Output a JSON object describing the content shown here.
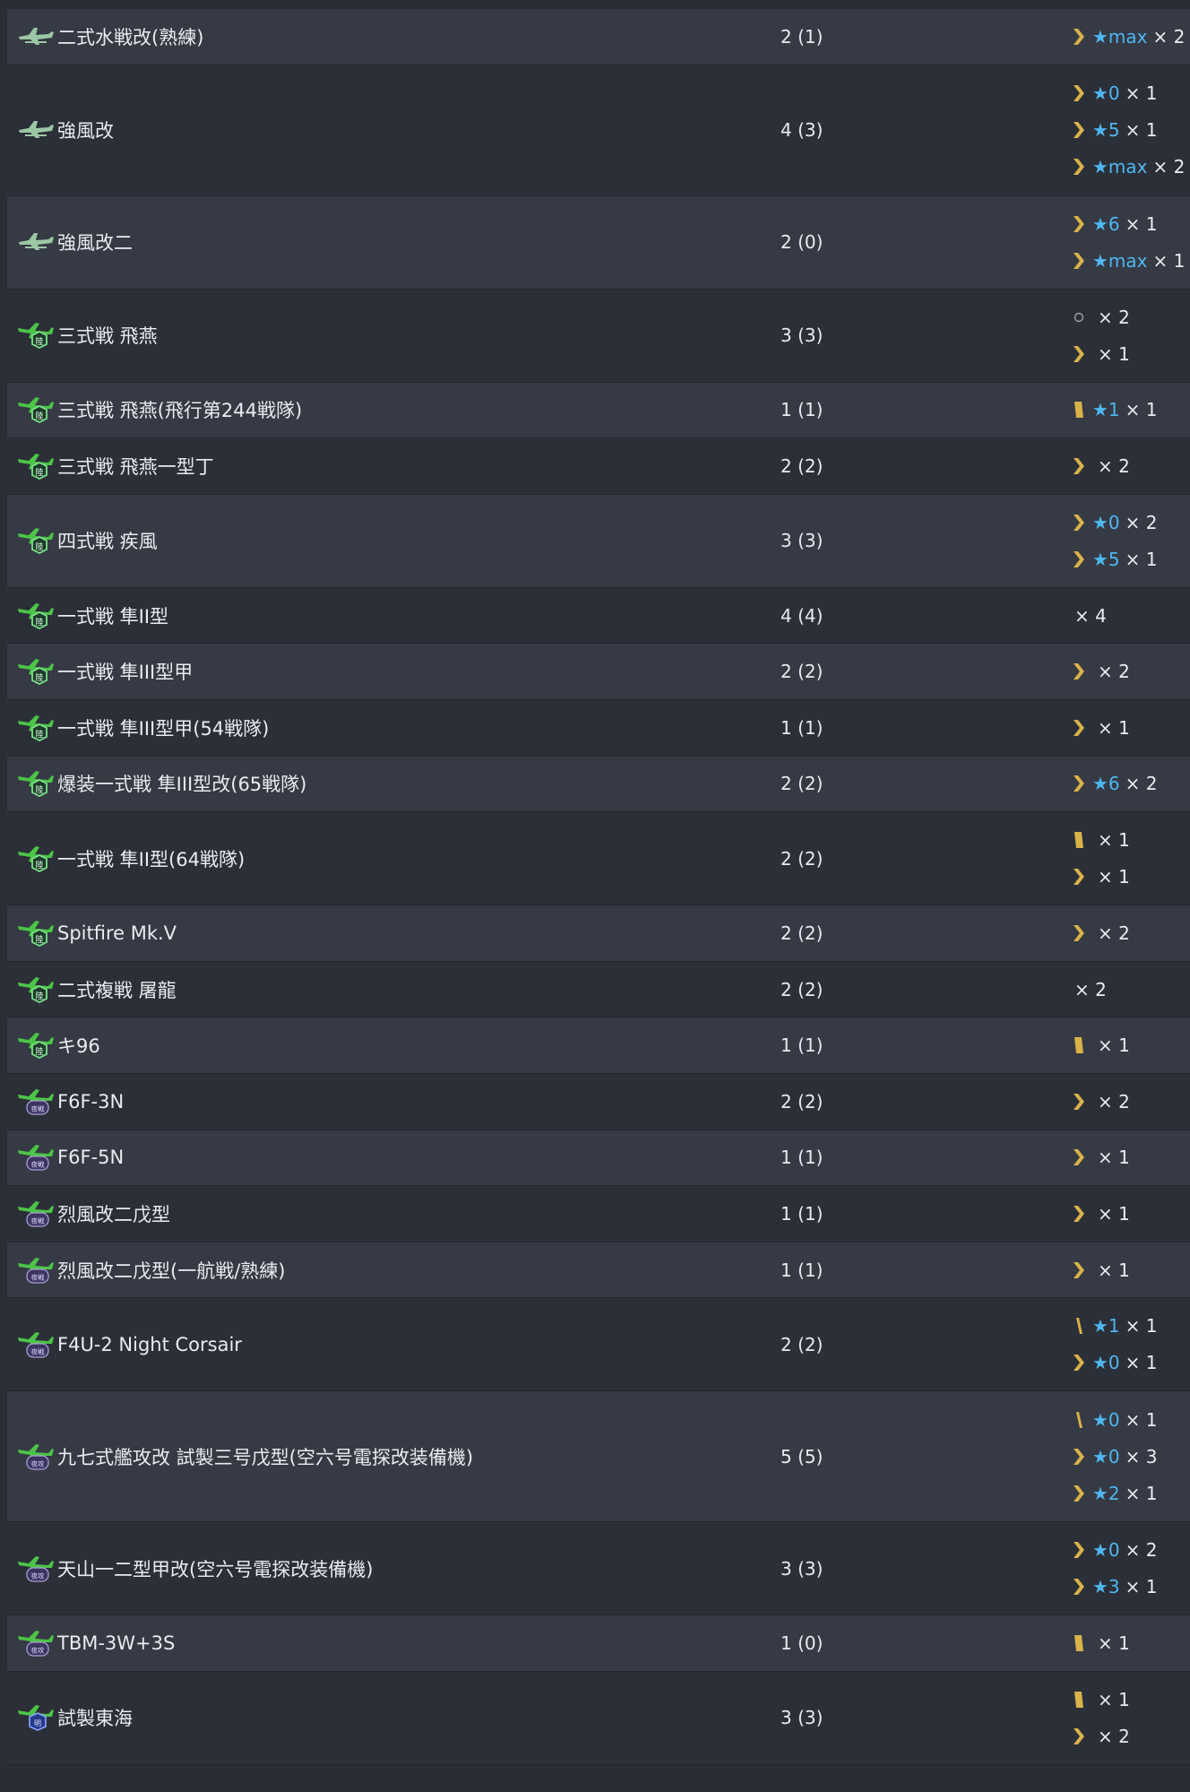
{
  "rows": [
    {
      "icon": "seaplane-fighter-icon",
      "name": "二式水戦改(熟練)",
      "count": "2 (1)",
      "prof": [
        {
          "icon": "chevron-double",
          "star": "★max",
          "mult": "× 2"
        }
      ]
    },
    {
      "icon": "seaplane-fighter-icon",
      "name": "強風改",
      "count": "4 (3)",
      "prof": [
        {
          "icon": "chevron-double",
          "star": "★0",
          "mult": "× 1"
        },
        {
          "icon": "chevron-double",
          "star": "★5",
          "mult": "× 1"
        },
        {
          "icon": "chevron-double",
          "star": "★max",
          "mult": "× 2"
        }
      ]
    },
    {
      "icon": "seaplane-fighter-icon",
      "name": "強風改二",
      "count": "2 (0)",
      "prof": [
        {
          "icon": "chevron-double",
          "star": "★6",
          "mult": "× 1"
        },
        {
          "icon": "chevron-double",
          "star": "★max",
          "mult": "× 1"
        }
      ]
    },
    {
      "icon": "army-fighter-icon",
      "name": "三式戦 飛燕",
      "count": "3 (3)",
      "prof": [
        {
          "icon": "circle-empty",
          "star": "",
          "mult": "× 2"
        },
        {
          "icon": "chevron-double",
          "star": "",
          "mult": "× 1"
        }
      ]
    },
    {
      "icon": "army-fighter-icon",
      "name": "三式戦 飛燕(飛行第244戦隊)",
      "count": "1 (1)",
      "prof": [
        {
          "icon": "bar-single",
          "star": "★1",
          "mult": "× 1"
        }
      ]
    },
    {
      "icon": "army-fighter-icon",
      "name": "三式戦 飛燕一型丁",
      "count": "2 (2)",
      "prof": [
        {
          "icon": "chevron-double",
          "star": "",
          "mult": "× 2"
        }
      ]
    },
    {
      "icon": "army-fighter-icon",
      "name": "四式戦 疾風",
      "count": "3 (3)",
      "prof": [
        {
          "icon": "chevron-double",
          "star": "★0",
          "mult": "× 2"
        },
        {
          "icon": "chevron-double",
          "star": "★5",
          "mult": "× 1"
        }
      ]
    },
    {
      "icon": "army-fighter-icon",
      "name": "一式戦 隼II型",
      "count": "4 (4)",
      "prof": [
        {
          "icon": "none",
          "star": "",
          "mult": "× 4"
        }
      ]
    },
    {
      "icon": "army-fighter-icon",
      "name": "一式戦 隼III型甲",
      "count": "2 (2)",
      "prof": [
        {
          "icon": "chevron-double",
          "star": "",
          "mult": "× 2"
        }
      ]
    },
    {
      "icon": "army-fighter-icon",
      "name": "一式戦 隼III型甲(54戦隊)",
      "count": "1 (1)",
      "prof": [
        {
          "icon": "chevron-double",
          "star": "",
          "mult": "× 1"
        }
      ]
    },
    {
      "icon": "army-fighter-icon",
      "name": "爆装一式戦 隼III型改(65戦隊)",
      "count": "2 (2)",
      "prof": [
        {
          "icon": "chevron-double",
          "star": "★6",
          "mult": "× 2"
        }
      ]
    },
    {
      "icon": "army-fighter-icon",
      "name": "一式戦 隼II型(64戦隊)",
      "count": "2 (2)",
      "prof": [
        {
          "icon": "bar-single",
          "star": "",
          "mult": "× 1"
        },
        {
          "icon": "chevron-double",
          "star": "",
          "mult": "× 1"
        }
      ]
    },
    {
      "icon": "army-fighter-icon",
      "name": "Spitfire Mk.V",
      "count": "2 (2)",
      "prof": [
        {
          "icon": "chevron-double",
          "star": "",
          "mult": "× 2"
        }
      ]
    },
    {
      "icon": "army-fighter-icon",
      "name": "二式複戦 屠龍",
      "count": "2 (2)",
      "prof": [
        {
          "icon": "none",
          "star": "",
          "mult": "× 2"
        }
      ]
    },
    {
      "icon": "army-fighter-icon",
      "name": "キ96",
      "count": "1 (1)",
      "prof": [
        {
          "icon": "bar-single",
          "star": "",
          "mult": "× 1"
        }
      ]
    },
    {
      "icon": "night-fighter-icon",
      "name": "F6F-3N",
      "count": "2 (2)",
      "prof": [
        {
          "icon": "chevron-double",
          "star": "",
          "mult": "× 2"
        }
      ]
    },
    {
      "icon": "night-fighter-icon",
      "name": "F6F-5N",
      "count": "1 (1)",
      "prof": [
        {
          "icon": "chevron-double",
          "star": "",
          "mult": "× 1"
        }
      ]
    },
    {
      "icon": "night-fighter-icon",
      "name": "烈風改二戊型",
      "count": "1 (1)",
      "prof": [
        {
          "icon": "chevron-double",
          "star": "",
          "mult": "× 1"
        }
      ]
    },
    {
      "icon": "night-fighter-icon",
      "name": "烈風改二戊型(一航戦/熟練)",
      "count": "1 (1)",
      "prof": [
        {
          "icon": "chevron-double",
          "star": "",
          "mult": "× 1"
        }
      ]
    },
    {
      "icon": "night-fighter-icon",
      "name": "F4U-2 Night Corsair",
      "count": "2 (2)",
      "prof": [
        {
          "icon": "bar-thin",
          "star": "★1",
          "mult": "× 1"
        },
        {
          "icon": "chevron-double",
          "star": "★0",
          "mult": "× 1"
        }
      ]
    },
    {
      "icon": "night-attacker-icon",
      "name": "九七式艦攻改 試製三号戊型(空六号電探改装備機)",
      "count": "5 (5)",
      "prof": [
        {
          "icon": "bar-thin",
          "star": "★0",
          "mult": "× 1"
        },
        {
          "icon": "chevron-double",
          "star": "★0",
          "mult": "× 3"
        },
        {
          "icon": "chevron-double",
          "star": "★2",
          "mult": "× 1"
        }
      ]
    },
    {
      "icon": "night-attacker-icon",
      "name": "天山一二型甲改(空六号電探改装備機)",
      "count": "3 (3)",
      "prof": [
        {
          "icon": "chevron-double",
          "star": "★0",
          "mult": "× 2"
        },
        {
          "icon": "chevron-double",
          "star": "★3",
          "mult": "× 1"
        }
      ]
    },
    {
      "icon": "night-attacker-icon",
      "name": "TBM-3W+3S",
      "count": "1 (0)",
      "prof": [
        {
          "icon": "bar-single",
          "star": "",
          "mult": "× 1"
        }
      ]
    },
    {
      "icon": "army-bomber-icon",
      "name": "試製東海",
      "count": "3 (3)",
      "prof": [
        {
          "icon": "bar-single",
          "star": "",
          "mult": "× 1"
        },
        {
          "icon": "chevron-double",
          "star": "",
          "mult": "× 2"
        }
      ]
    }
  ],
  "colors": {
    "accent_star": "#4fb6f0",
    "prof_gold": "#d9b24a"
  }
}
